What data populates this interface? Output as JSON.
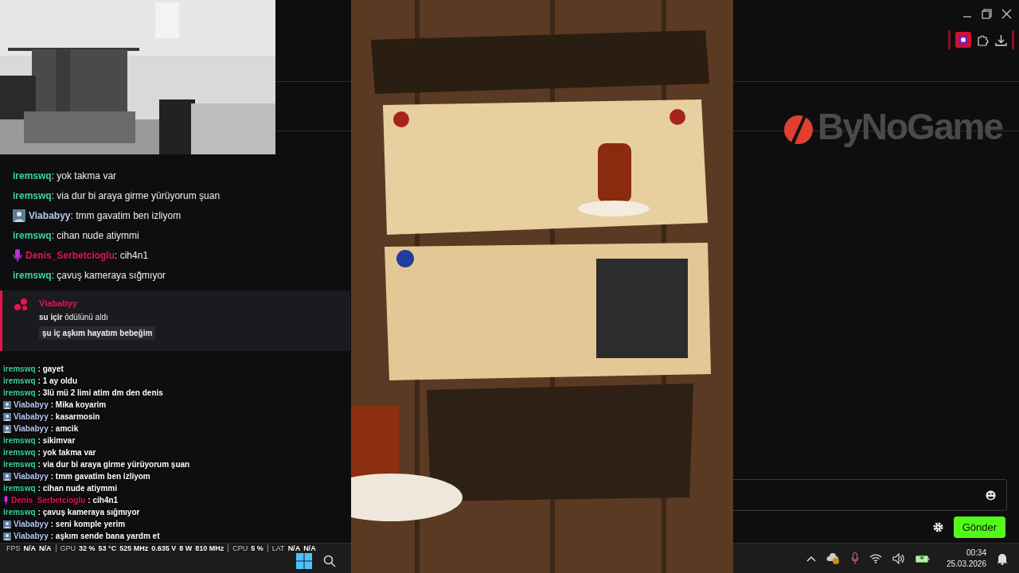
{
  "logo": {
    "text": "ByNoGame"
  },
  "chat": {
    "messages": [
      {
        "kind": "plain",
        "user": "iremswq",
        "color": "#3fd39a",
        "text": ": yok takma var"
      },
      {
        "kind": "plain",
        "user": "iremswq",
        "color": "#3fd39a",
        "text": ": via dur bi araya girme yürüyorum şuan"
      },
      {
        "kind": "avatar",
        "user": "Viababyy",
        "color": "#b9c9f2",
        "text": ": tmm gavatim ben izliyom"
      },
      {
        "kind": "plain",
        "user": "iremswq",
        "color": "#3fd39a",
        "text": ": cihan nude atiymmi"
      },
      {
        "kind": "mic",
        "user": "Denis_Serbetcioglu",
        "color": "#e3164f",
        "text": ": cih4n1"
      },
      {
        "kind": "plain",
        "user": "iremswq",
        "color": "#3fd39a",
        "text": ": çavuş kameraya sığmıyor"
      }
    ],
    "redemption": {
      "user": "Viababyy",
      "reward": "**su içir** ödülünü aldı",
      "message": "şu iç aşkım hayatım bebeğim"
    }
  },
  "send_button": "Gönder",
  "overlay_chat": [
    {
      "kind": "plain",
      "user": "iremswq",
      "color": "#3fd39a",
      "text": ": gayet"
    },
    {
      "kind": "plain",
      "user": "iremswq",
      "color": "#3fd39a",
      "text": ": 1 ay oldu"
    },
    {
      "kind": "plain",
      "user": "iremswq",
      "color": "#3fd39a",
      "text": ": 3lü mü 2 limi atim dm den denis"
    },
    {
      "kind": "avatar",
      "user": "Viababyy",
      "color": "#b9c9f2",
      "text": ": Mika koyarim"
    },
    {
      "kind": "avatar",
      "user": "Viababyy",
      "color": "#b9c9f2",
      "text": ": kasarmosin"
    },
    {
      "kind": "avatar",
      "user": "Viababyy",
      "color": "#b9c9f2",
      "text": ": amcik"
    },
    {
      "kind": "plain",
      "user": "iremswq",
      "color": "#3fd39a",
      "text": ": sikimvar"
    },
    {
      "kind": "plain",
      "user": "iremswq",
      "color": "#3fd39a",
      "text": ": yok takma var"
    },
    {
      "kind": "plain",
      "user": "iremswq",
      "color": "#3fd39a",
      "text": ": via dur bi araya girme yürüyorum şuan"
    },
    {
      "kind": "avatar",
      "user": "Viababyy",
      "color": "#b9c9f2",
      "text": ": tmm gavatim ben izliyom"
    },
    {
      "kind": "plain",
      "user": "iremswq",
      "color": "#3fd39a",
      "text": ": cihan nude atiymmi"
    },
    {
      "kind": "mic",
      "user": "Denis_Serbetcioglu",
      "color": "#e3164f",
      "text": ": cih4n1"
    },
    {
      "kind": "plain",
      "user": "iremswq",
      "color": "#3fd39a",
      "text": ": çavuş kameraya sığmıyor"
    },
    {
      "kind": "avatar",
      "user": "Viababyy",
      "color": "#b9c9f2",
      "text": ": seni komple yerim"
    },
    {
      "kind": "avatar",
      "user": "Viababyy",
      "color": "#b9c9f2",
      "text": ": aşkım sende bana yardm et"
    }
  ],
  "stats": [
    {
      "label": "FPS",
      "values": [
        "N/A",
        "N/A"
      ]
    },
    {
      "label": "GPU",
      "values": [
        "32 %",
        "53 °C",
        "525 MHz",
        "0.635 V",
        "8 W",
        "810 MHz"
      ]
    },
    {
      "label": "CPU",
      "values": [
        "5 %"
      ]
    },
    {
      "label": "LAT",
      "values": [
        "N/A",
        "N/A"
      ]
    }
  ],
  "taskbar": {
    "time": "00:34",
    "date": "25.03.2026"
  }
}
